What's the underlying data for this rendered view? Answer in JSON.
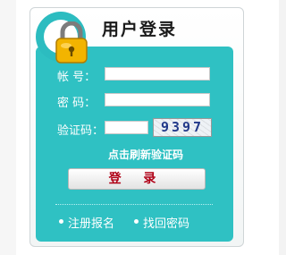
{
  "login": {
    "title": "用户登录",
    "fields": {
      "account_label": "帐  号：",
      "password_label": "密  码：",
      "captcha_label": "验证码："
    },
    "captcha_text": "9397",
    "refresh_text": "点击刷新验证码",
    "submit_label": "登 录",
    "links": {
      "register": "注册报名",
      "recover_password": "找回密码"
    }
  },
  "colors": {
    "panel_teal": "#2fc1c3",
    "button_text": "#b00016",
    "lock_gold": "#f2b400"
  },
  "icons": {
    "logo": "padlock-icon"
  }
}
